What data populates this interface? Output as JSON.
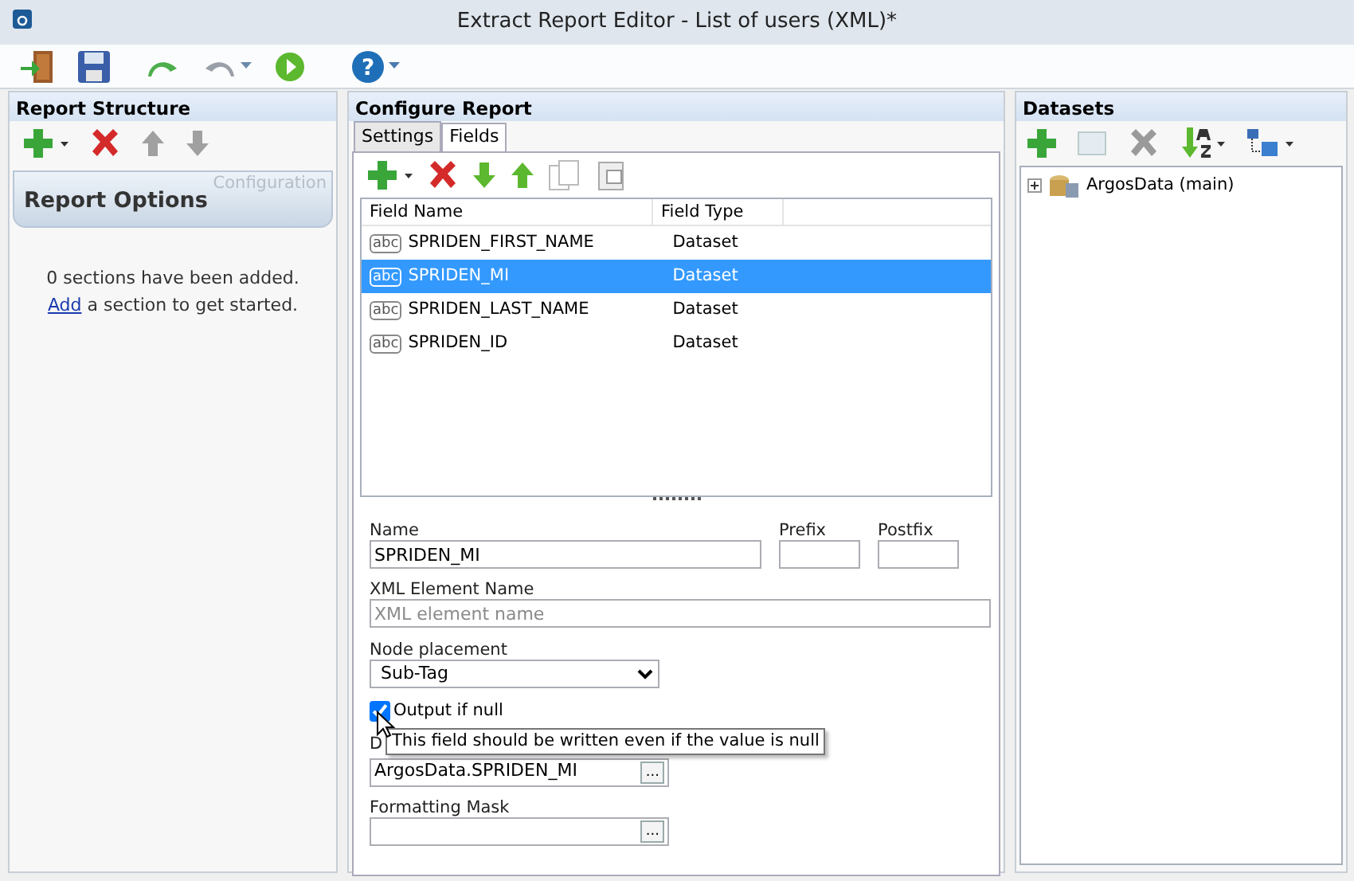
{
  "window": {
    "title": "Extract Report Editor - List of users (XML)*"
  },
  "toolbar": {
    "help_glyph": "?"
  },
  "report_structure": {
    "title": "Report Structure",
    "options_title": "Report Options",
    "options_caption": "Configuration",
    "empty_before": "0 sections have been added.",
    "empty_link": "Add",
    "empty_after": "a section to get started."
  },
  "configure": {
    "title": "Configure Report",
    "tabs": [
      {
        "label": "Settings",
        "selected": false
      },
      {
        "label": "Fields",
        "selected": true
      }
    ],
    "columns": [
      "Field Name",
      "Field Type"
    ],
    "rows": [
      {
        "badge": "abc",
        "name": "SPRIDEN_FIRST_NAME",
        "field_type": "Dataset",
        "selected": false
      },
      {
        "badge": "abc",
        "name": "SPRIDEN_MI",
        "field_type": "Dataset",
        "selected": true
      },
      {
        "badge": "abc",
        "name": "SPRIDEN_LAST_NAME",
        "field_type": "Dataset",
        "selected": false
      },
      {
        "badge": "abc",
        "name": "SPRIDEN_ID",
        "field_type": "Dataset",
        "selected": false
      }
    ],
    "form": {
      "name_label": "Name",
      "name_value": "SPRIDEN_MI",
      "prefix_label": "Prefix",
      "postfix_label": "Postfix",
      "xml_label": "XML Element Name",
      "xml_placeholder": "XML element name",
      "node_label": "Node placement",
      "node_value": "Sub-Tag",
      "output_null": {
        "label": "Output if null",
        "checked": true
      },
      "tooltip": "This field should be written even if the value is null",
      "data_label": "D",
      "data_value": "ArgosData.SPRIDEN_MI",
      "data_browse": "...",
      "mask_label": "Formatting Mask",
      "mask_browse": "..."
    }
  },
  "datasets": {
    "title": "Datasets",
    "tree": [
      {
        "label": "ArgosData (main)",
        "expanded": false
      }
    ]
  }
}
